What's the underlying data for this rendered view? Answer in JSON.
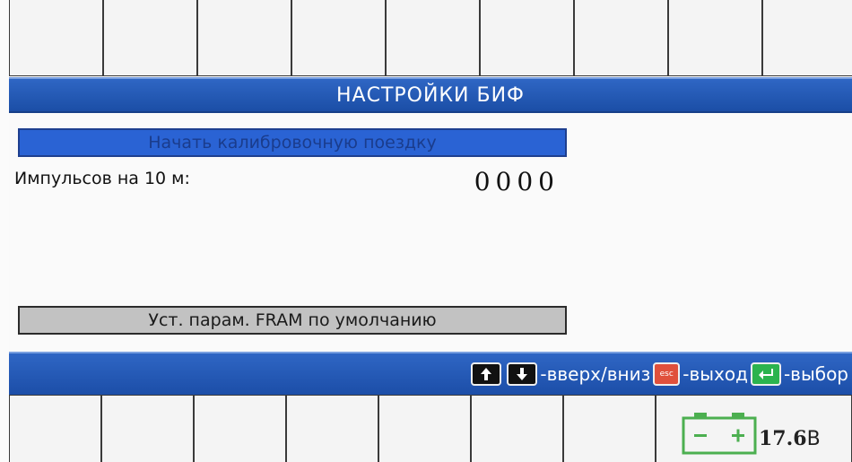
{
  "header": {
    "title": "НАСТРОЙКИ БИФ"
  },
  "menu": {
    "calibrate_label": "Начать калибровочную поездку",
    "pulses_label": "Импульсов на 10 м:",
    "pulses_value": "0000",
    "default_fram_label": "Уст. парам. FRAM по умолчанию"
  },
  "hints": {
    "up_icon": "arrow-up-icon",
    "down_icon": "arrow-down-icon",
    "updown_text": "-вверх/вниз",
    "esc_key": "esc",
    "exit_text": "-выход",
    "enter_icon": "enter-icon",
    "select_text": "-выбор"
  },
  "battery": {
    "voltage": "17.6",
    "unit": "В"
  },
  "colors": {
    "accent": "#1f56b8",
    "selected_item": "#2a63d4",
    "battery": "#4caf50",
    "esc": "#e0503c",
    "enter": "#2bb34e"
  }
}
